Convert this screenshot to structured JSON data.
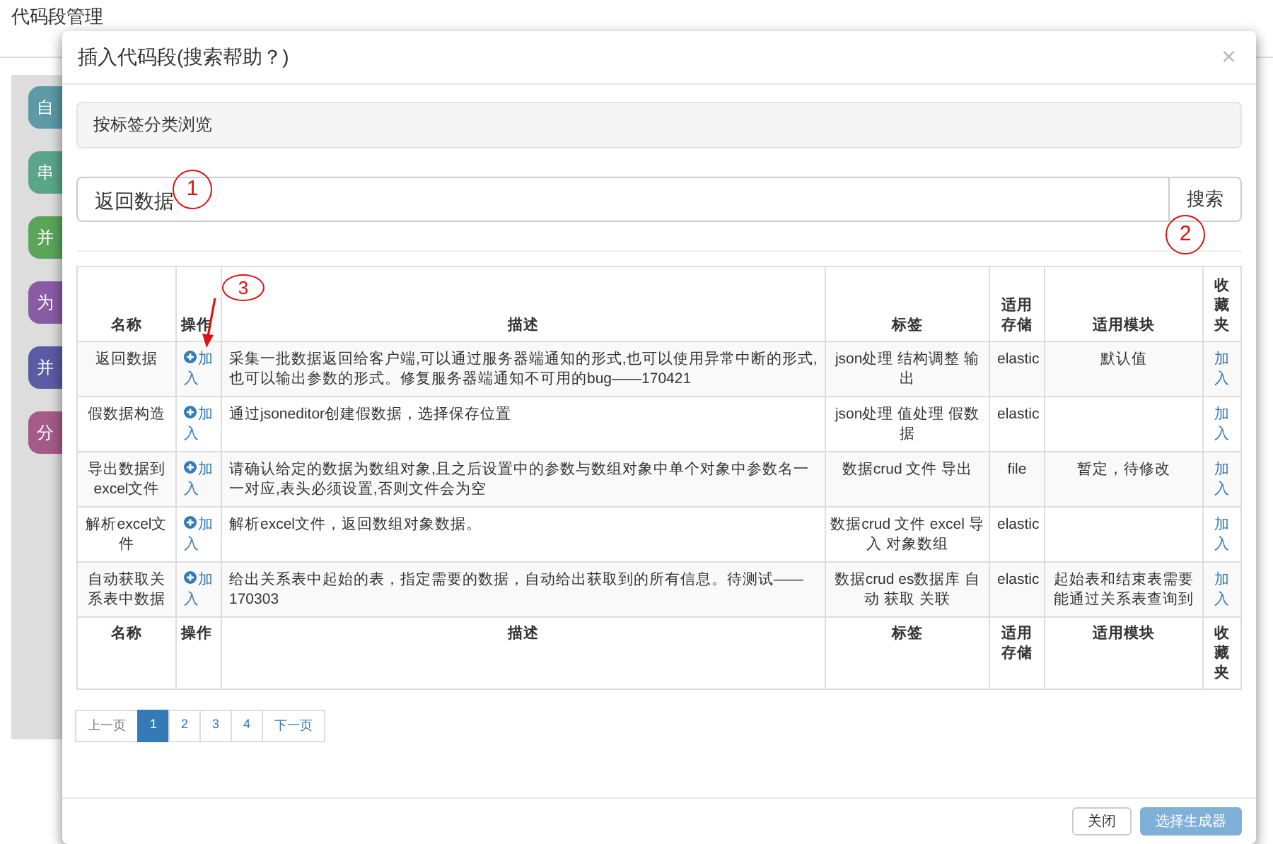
{
  "page": {
    "title": "代码段管理",
    "blocks": [
      {
        "label": "自",
        "color": "#5b9aa6"
      },
      {
        "label": "串",
        "color": "#5ba58a"
      },
      {
        "label": "并",
        "color": "#5ba55b"
      },
      {
        "label": "为",
        "color": "#8a5ba5"
      },
      {
        "label": "并",
        "color": "#5b5ba5"
      },
      {
        "label": "分",
        "color": "#a55b8a"
      }
    ]
  },
  "modal": {
    "title": "插入代码段(搜索帮助？)",
    "close": "×",
    "browse_panel": "按标签分类浏览",
    "search": {
      "value": "返回数据",
      "button": "搜索"
    },
    "annotations": [
      "1",
      "2",
      "3"
    ],
    "table": {
      "columns": [
        "名称",
        "操作",
        "描述",
        "标签",
        "适用存储",
        "适用模块",
        "收藏夹"
      ],
      "rows": [
        {
          "name": "返回数据",
          "action": "加入",
          "description": "采集一批数据返回给客户端,可以通过服务器端通知的形式,也可以使用异常中断的形式,也可以输出参数的形式。修复服务器端通知不可用的bug——170421",
          "tags": "json处理 结构调整 输出",
          "storage": "elastic",
          "module": "默认值",
          "favorite": "加入"
        },
        {
          "name": "假数据构造",
          "action": "加入",
          "description": "通过jsoneditor创建假数据，选择保存位置",
          "tags": "json处理 值处理 假数据",
          "storage": "elastic",
          "module": "",
          "favorite": "加入"
        },
        {
          "name": "导出数据到excel文件",
          "action": "加入",
          "description": "请确认给定的数据为数组对象,且之后设置中的参数与数组对象中单个对象中参数名一一对应,表头必须设置,否则文件会为空",
          "tags": "数据crud 文件 导出",
          "storage": "file",
          "module": "暂定，待修改",
          "favorite": "加入"
        },
        {
          "name": "解析excel文件",
          "action": "加入",
          "description": "解析excel文件，返回数组对象数据。",
          "tags": "数据crud 文件 excel 导入 对象数组",
          "storage": "elastic",
          "module": "",
          "favorite": "加入"
        },
        {
          "name": "自动获取关系表中数据",
          "action": "加入",
          "description": "给出关系表中起始的表，指定需要的数据，自动给出获取到的所有信息。待测试——170303",
          "tags": "数据crud es数据库 自动 获取 关联",
          "storage": "elastic",
          "module": "起始表和结束表需要能通过关系表查询到",
          "favorite": "加入"
        }
      ],
      "footer_columns": [
        "名称",
        "操作",
        "描述",
        "标签",
        "适用存储",
        "适用模块",
        "收藏夹"
      ]
    },
    "pagination": {
      "previous": "上一页",
      "pages": [
        {
          "label": "1",
          "selected": true
        },
        {
          "label": "2",
          "selected": false
        },
        {
          "label": "3",
          "selected": false
        },
        {
          "label": "4",
          "selected": false
        }
      ],
      "next": "下一页"
    },
    "buttons": [
      "关闭",
      "选择生成器"
    ]
  }
}
